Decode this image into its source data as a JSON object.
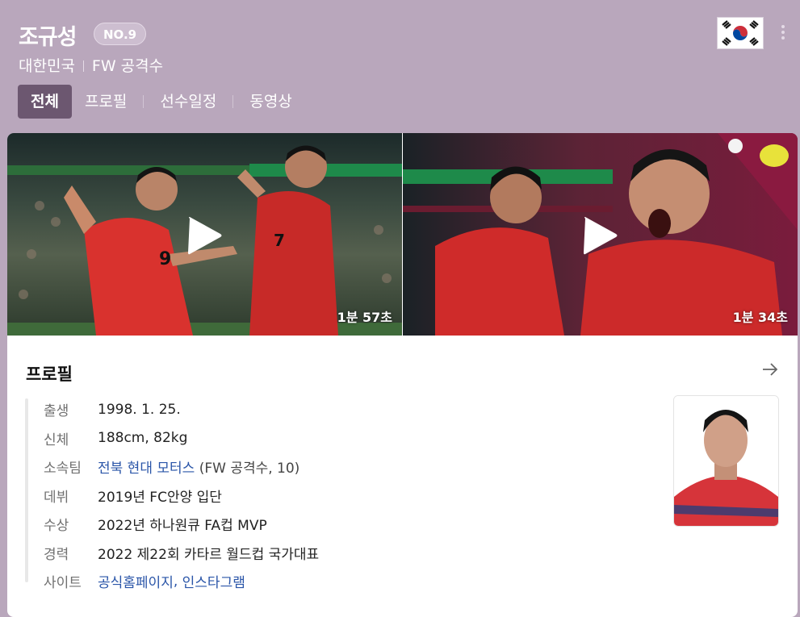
{
  "player": {
    "name": "조규성",
    "number_badge": "NO.9",
    "nationality": "대한민국",
    "position": "FW 공격수"
  },
  "icons": {
    "flag": "south-korea-flag-icon",
    "more": "more-vertical-icon",
    "arrow": "arrow-right-icon",
    "play": "play-icon"
  },
  "tabs": [
    {
      "label": "전체",
      "active": true
    },
    {
      "label": "프로필",
      "active": false
    },
    {
      "label": "선수일정",
      "active": false
    },
    {
      "label": "동영상",
      "active": false
    }
  ],
  "videos": [
    {
      "duration": "1분 57초"
    },
    {
      "duration": "1분 34초"
    }
  ],
  "profile": {
    "title": "프로필",
    "rows": [
      {
        "label": "출생",
        "value": "1998. 1. 25."
      },
      {
        "label": "신체",
        "value": "188cm, 82kg"
      },
      {
        "label": "소속팀",
        "link": "전북 현대 모터스",
        "note": "(FW 공격수, 10)"
      },
      {
        "label": "데뷔",
        "value": "2019년 FC안양 입단"
      },
      {
        "label": "수상",
        "value": "2022년 하나원큐 FA컵 MVP"
      },
      {
        "label": "경력",
        "value": "2022 제22회 카타르 월드컵 국가대표"
      },
      {
        "label": "사이트",
        "link1": "공식홈페이지",
        "sep": ", ",
        "link2": "인스타그램"
      }
    ]
  },
  "colors": {
    "header_bg": "#b9a7bc",
    "active_tab": "#6c5770",
    "link": "#2a55a8"
  }
}
